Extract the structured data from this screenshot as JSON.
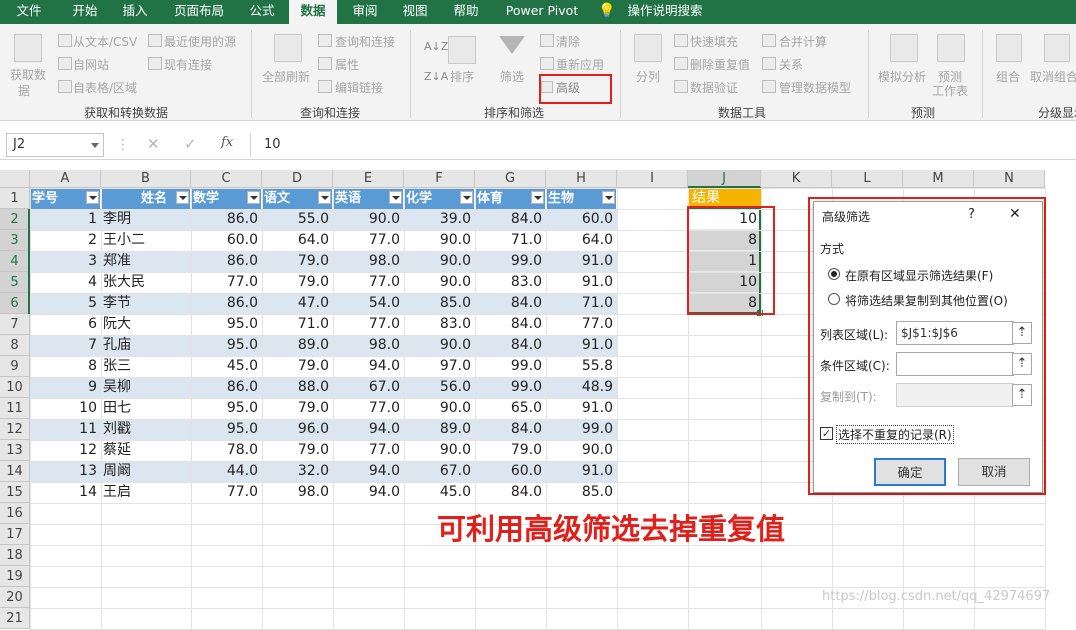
{
  "ribbon": {
    "tabs": [
      "文件",
      "开始",
      "插入",
      "页面布局",
      "公式",
      "数据",
      "审阅",
      "视图",
      "帮助",
      "Power Pivot",
      "操作说明搜索"
    ],
    "active_tab": "数据",
    "get_data": {
      "big": "获取数",
      "big2": "据",
      "from_text": "从文本/CSV",
      "from_web": "自网站",
      "from_table": "自表格/区域",
      "recent": "最近使用的源",
      "existing": "现有连接",
      "group": "获取和转换数据"
    },
    "queries": {
      "refresh": "全部刷新",
      "queries": "查询和连接",
      "properties": "属性",
      "edit_links": "编辑链接",
      "group": "查询和连接"
    },
    "sort_filter": {
      "sort": "排序",
      "filter": "筛选",
      "clear": "清除",
      "reapply": "重新应用",
      "advanced": "高级",
      "group": "排序和筛选"
    },
    "data_tools": {
      "split": "分列",
      "flash_fill": "快速填充",
      "remove_dup": "删除重复值",
      "validation": "数据验证",
      "consolidate": "合并计算",
      "relations": "关系",
      "manage_model": "管理数据模型",
      "group": "数据工具"
    },
    "forecast": {
      "what_if": "模拟分析",
      "forecast_sheet": "预测",
      "forecast_sheet2": "工作表",
      "group": "预测"
    },
    "outline": {
      "group_btn": "组合",
      "ungroup": "取消组合",
      "group": "分级显示"
    }
  },
  "formula_bar": {
    "name_box": "J2",
    "value": "10",
    "fx": "fx"
  },
  "columns": [
    "A",
    "B",
    "C",
    "D",
    "E",
    "F",
    "G",
    "H",
    "I",
    "J",
    "K",
    "L",
    "M",
    "N"
  ],
  "rows": [
    "1",
    "2",
    "3",
    "4",
    "5",
    "6",
    "7",
    "8",
    "9",
    "10",
    "11",
    "12",
    "13",
    "14",
    "15",
    "16",
    "17",
    "18",
    "19",
    "20",
    "21"
  ],
  "table": {
    "headers": [
      "学号",
      "姓名",
      "数学",
      "语文",
      "英语",
      "化学",
      "体育",
      "生物"
    ],
    "rows": [
      [
        "1",
        "李明",
        "86.0",
        "55.0",
        "90.0",
        "39.0",
        "84.0",
        "60.0"
      ],
      [
        "2",
        "王小二",
        "60.0",
        "64.0",
        "77.0",
        "90.0",
        "71.0",
        "64.0"
      ],
      [
        "3",
        "郑准",
        "86.0",
        "79.0",
        "98.0",
        "90.0",
        "99.0",
        "91.0"
      ],
      [
        "4",
        "张大民",
        "77.0",
        "79.0",
        "77.0",
        "90.0",
        "83.0",
        "91.0"
      ],
      [
        "5",
        "李节",
        "86.0",
        "47.0",
        "54.0",
        "85.0",
        "84.0",
        "71.0"
      ],
      [
        "6",
        "阮大",
        "95.0",
        "71.0",
        "77.0",
        "83.0",
        "84.0",
        "77.0"
      ],
      [
        "7",
        "孔庙",
        "95.0",
        "89.0",
        "98.0",
        "90.0",
        "84.0",
        "91.0"
      ],
      [
        "8",
        "张三",
        "45.0",
        "79.0",
        "94.0",
        "97.0",
        "99.0",
        "55.8"
      ],
      [
        "9",
        "吴柳",
        "86.0",
        "88.0",
        "67.0",
        "56.0",
        "99.0",
        "48.9"
      ],
      [
        "10",
        "田七",
        "95.0",
        "79.0",
        "77.0",
        "90.0",
        "65.0",
        "91.0"
      ],
      [
        "11",
        "刘戳",
        "95.0",
        "96.0",
        "94.0",
        "89.0",
        "84.0",
        "99.0"
      ],
      [
        "12",
        "蔡延",
        "78.0",
        "79.0",
        "77.0",
        "90.0",
        "79.0",
        "90.0"
      ],
      [
        "13",
        "周阚",
        "44.0",
        "32.0",
        "94.0",
        "67.0",
        "60.0",
        "91.0"
      ],
      [
        "14",
        "王启",
        "77.0",
        "98.0",
        "94.0",
        "45.0",
        "84.0",
        "85.0"
      ]
    ]
  },
  "result": {
    "header": "结果",
    "values": [
      "10",
      "8",
      "1",
      "10",
      "8"
    ]
  },
  "dialog": {
    "title": "高级筛选",
    "help": "?",
    "close": "✕",
    "section": "方式",
    "opt1": "在原有区域显示筛选结果(F)",
    "opt2": "将筛选结果复制到其他位置(O)",
    "list_label": "列表区域(L):",
    "list_value": "$J$1:$J$6",
    "criteria_label": "条件区域(C):",
    "criteria_value": "",
    "copy_label": "复制到(T):",
    "copy_value": "",
    "unique_label": "选择不重复的记录(R)",
    "ok": "确定",
    "cancel": "取消"
  },
  "annotation": "可利用高级筛选去掉重复值",
  "watermark": "https://blog.csdn.net/qq_42974697",
  "colors": {
    "excel_green": "#217346",
    "table_header": "#5b9bd5",
    "band": "#dce6f1",
    "result_header": "#f4b400",
    "red": "#e0201b"
  }
}
